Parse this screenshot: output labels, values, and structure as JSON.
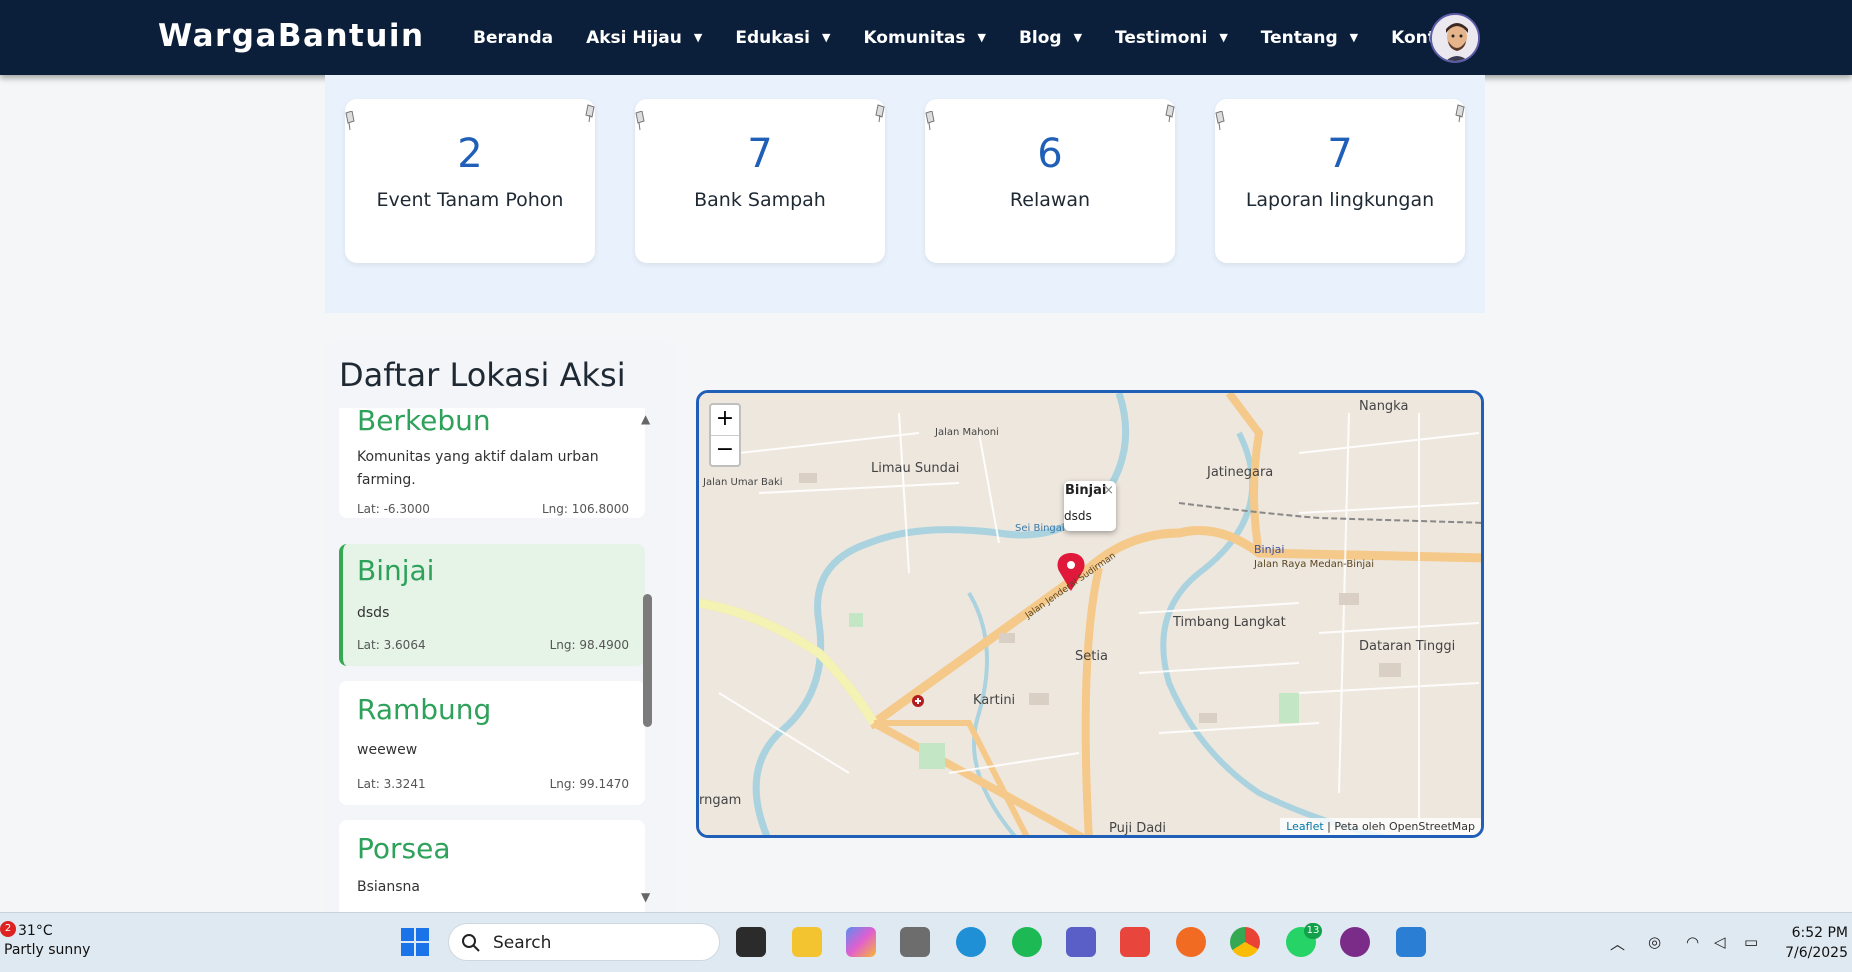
{
  "brand": "WargaBantuin",
  "nav": [
    {
      "label": "Beranda",
      "dropdown": false
    },
    {
      "label": "Aksi Hijau",
      "dropdown": true
    },
    {
      "label": "Edukasi",
      "dropdown": true
    },
    {
      "label": "Komunitas",
      "dropdown": true
    },
    {
      "label": "Blog",
      "dropdown": true
    },
    {
      "label": "Testimoni",
      "dropdown": true
    },
    {
      "label": "Tentang",
      "dropdown": true
    },
    {
      "label": "Kontak",
      "dropdown": true
    }
  ],
  "stats": [
    {
      "value": "2",
      "label": "Event Tanam Pohon"
    },
    {
      "value": "7",
      "label": "Bank Sampah"
    },
    {
      "value": "6",
      "label": "Relawan"
    },
    {
      "value": "7",
      "label": "Laporan lingkungan"
    }
  ],
  "locations": {
    "title": "Daftar Lokasi Aksi",
    "items": [
      {
        "name": "Berkebun",
        "desc": "Komunitas yang aktif dalam urban farming.",
        "lat": "Lat: -6.3000",
        "lng": "Lng: 106.8000",
        "active": false
      },
      {
        "name": "Binjai",
        "desc": "dsds",
        "lat": "Lat: 3.6064",
        "lng": "Lng: 98.4900",
        "active": true
      },
      {
        "name": "Rambung",
        "desc": "weewew",
        "lat": "Lat: 3.3241",
        "lng": "Lng: 99.1470",
        "active": false
      },
      {
        "name": "Porsea",
        "desc": "Bsiansna",
        "lat": "",
        "lng": "",
        "active": false
      }
    ]
  },
  "map": {
    "zoom_in": "+",
    "zoom_out": "−",
    "popup": {
      "title": "Binjai",
      "desc": "dsds",
      "close": "×"
    },
    "attribution_link": "Leaflet",
    "attribution_text": " | Peta oleh OpenStreetMap",
    "labels": [
      "Limau Sundai",
      "Jatinegara",
      "Binjai",
      "Jalan Raya Medan-Binjai",
      "Timbang Langkat",
      "Dataran Tinggi",
      "Setia",
      "Kartini",
      "Puji Dadi",
      "Nangka",
      "Jalan Umar Baki",
      "Jalan Mahoni",
      "Sei Bingai",
      "Jalan Jenderal Sudirman",
      "rngam"
    ]
  },
  "taskbar": {
    "weather_temp": "31°C",
    "weather_desc": "Partly sunny",
    "weather_badge": "2",
    "search": "Search",
    "chat_badge": "13",
    "time": "6:52 PM",
    "date": "7/6/2025"
  }
}
